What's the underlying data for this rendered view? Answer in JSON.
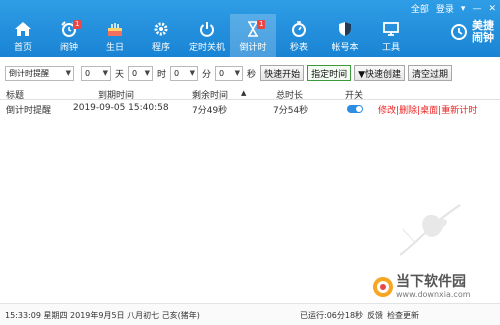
{
  "window": {
    "skin_label": "全部",
    "login_label": "登录",
    "menu_glyph": "▾",
    "minimize_glyph": "—",
    "close_glyph": "✕"
  },
  "nav": [
    {
      "label": "首页",
      "icon": "home-icon"
    },
    {
      "label": "闹钟",
      "icon": "alarm-clock-icon",
      "badge": "1"
    },
    {
      "label": "生日",
      "icon": "cake-icon"
    },
    {
      "label": "程序",
      "icon": "gear-icon"
    },
    {
      "label": "定时关机",
      "icon": "power-icon"
    },
    {
      "label": "倒计时",
      "icon": "hourglass-icon",
      "badge": "1",
      "active": true
    },
    {
      "label": "秒表",
      "icon": "stopwatch-icon"
    },
    {
      "label": "帐号本",
      "icon": "shield-icon"
    },
    {
      "label": "工具",
      "icon": "monitor-icon"
    }
  ],
  "brand": {
    "line1": "美捷",
    "line2": "闹钟"
  },
  "toolbar": {
    "type_value": "倒计时提醒",
    "days_value": "0",
    "days_unit": "天",
    "hours_value": "0",
    "hours_unit": "时",
    "minutes_value": "0",
    "minutes_unit": "分",
    "seconds_value": "0",
    "seconds_unit": "秒",
    "btn_quick_start": "快速开始",
    "btn_set_time": "指定时间",
    "btn_quick_create": "▼快速创建",
    "btn_clear_expired": "清空过期"
  },
  "table": {
    "headers": {
      "title": "标题",
      "due": "到期时间",
      "remaining": "剩余时间",
      "sort": "▲",
      "total": "总时长",
      "switch": "开关"
    },
    "rows": [
      {
        "title": "倒计时提醒",
        "due": "2019-09-05 15:40:58",
        "remaining": "7分49秒",
        "total": "7分54秒",
        "switch_on": true,
        "actions": [
          "修改",
          "删除",
          "桌面",
          "重新计时"
        ]
      }
    ]
  },
  "status": {
    "datetime": "15:33:09 星期四 2019年9月5日 八月初七 己亥(猪年)",
    "runtime": "已运行:06分18秒",
    "feedback": "反馈",
    "update": "检查更新"
  },
  "watermark": {
    "main": "当下软件园",
    "url": "www.downxia.com"
  },
  "colors": {
    "nav_bg": "#1a84d4",
    "accent": "#2c8de3",
    "action_red": "#e22222"
  }
}
